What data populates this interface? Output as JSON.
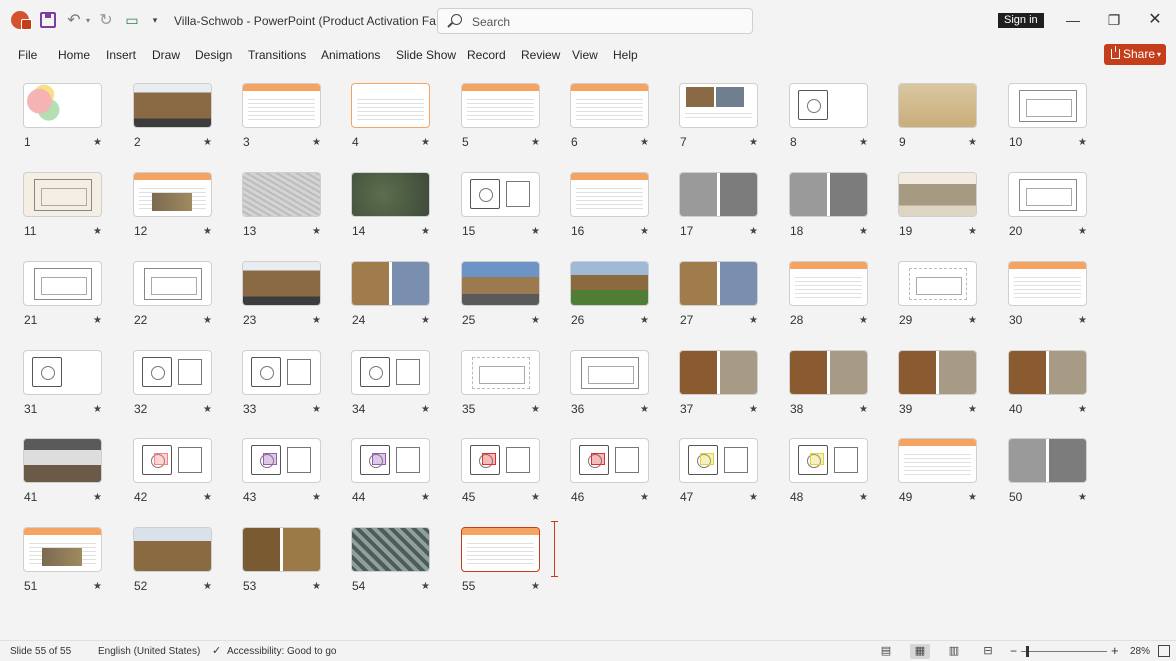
{
  "titlebar": {
    "app_icon": "powerpoint-icon",
    "doc_title": "Villa-Schwob  -  PowerPoint (Product Activation Fa...",
    "search_placeholder": "Search",
    "sign_in_label": "Sign in",
    "window_controls": [
      "minimize-icon",
      "restore-icon",
      "close-icon"
    ]
  },
  "ribbon": {
    "tabs": [
      "File",
      "Home",
      "Insert",
      "Draw",
      "Design",
      "Transitions",
      "Animations",
      "Slide Show",
      "Record",
      "Review",
      "View",
      "Help"
    ],
    "share_label": "Share"
  },
  "slides": [
    {
      "n": "1",
      "kind": "title"
    },
    {
      "n": "2",
      "kind": "photo-building"
    },
    {
      "n": "3",
      "kind": "text-figure"
    },
    {
      "n": "4",
      "kind": "text-orange"
    },
    {
      "n": "5",
      "kind": "text"
    },
    {
      "n": "6",
      "kind": "text-sketch"
    },
    {
      "n": "7",
      "kind": "photo-text"
    },
    {
      "n": "8",
      "kind": "plan"
    },
    {
      "n": "9",
      "kind": "drawing-old"
    },
    {
      "n": "10",
      "kind": "sketch-pair"
    },
    {
      "n": "11",
      "kind": "sketch-room"
    },
    {
      "n": "12",
      "kind": "text-map"
    },
    {
      "n": "13",
      "kind": "map"
    },
    {
      "n": "14",
      "kind": "aerial"
    },
    {
      "n": "15",
      "kind": "plan-lines"
    },
    {
      "n": "16",
      "kind": "text"
    },
    {
      "n": "17",
      "kind": "photo-bw-pair"
    },
    {
      "n": "18",
      "kind": "photo-bw-pair"
    },
    {
      "n": "19",
      "kind": "photo-sepia"
    },
    {
      "n": "20",
      "kind": "elevation"
    },
    {
      "n": "21",
      "kind": "elevation"
    },
    {
      "n": "22",
      "kind": "elevation"
    },
    {
      "n": "23",
      "kind": "photo-building"
    },
    {
      "n": "24",
      "kind": "photo-pair"
    },
    {
      "n": "25",
      "kind": "photo-street"
    },
    {
      "n": "26",
      "kind": "photo-garden"
    },
    {
      "n": "27",
      "kind": "photo-pair"
    },
    {
      "n": "28",
      "kind": "text"
    },
    {
      "n": "29",
      "kind": "sketch-light"
    },
    {
      "n": "30",
      "kind": "text"
    },
    {
      "n": "31",
      "kind": "plan"
    },
    {
      "n": "32",
      "kind": "plan-text"
    },
    {
      "n": "33",
      "kind": "plan-text"
    },
    {
      "n": "34",
      "kind": "plan-text"
    },
    {
      "n": "35",
      "kind": "sketch-light"
    },
    {
      "n": "36",
      "kind": "section"
    },
    {
      "n": "37",
      "kind": "photo-interior"
    },
    {
      "n": "38",
      "kind": "photo-interior"
    },
    {
      "n": "39",
      "kind": "photo-interior"
    },
    {
      "n": "40",
      "kind": "photo-interior"
    },
    {
      "n": "41",
      "kind": "photo-bedroom"
    },
    {
      "n": "42",
      "kind": "plan-color"
    },
    {
      "n": "43",
      "kind": "plan-purple"
    },
    {
      "n": "44",
      "kind": "plan-purple"
    },
    {
      "n": "45",
      "kind": "plan-red"
    },
    {
      "n": "46",
      "kind": "plan-red"
    },
    {
      "n": "47",
      "kind": "plan-yellow"
    },
    {
      "n": "48",
      "kind": "plan-yellow"
    },
    {
      "n": "49",
      "kind": "text"
    },
    {
      "n": "50",
      "kind": "photo-bw-pair"
    },
    {
      "n": "51",
      "kind": "text-photo"
    },
    {
      "n": "52",
      "kind": "photo-balcony"
    },
    {
      "n": "53",
      "kind": "photo-tree"
    },
    {
      "n": "54",
      "kind": "photo-grille"
    },
    {
      "n": "55",
      "kind": "text-selected"
    }
  ],
  "status": {
    "slide_counter": "Slide 55 of 55",
    "language": "English (United States)",
    "accessibility": "Accessibility: Good to go",
    "zoom": "28%"
  },
  "colors": {
    "accent": "#c43e1c",
    "slide_header": "#f4a460"
  }
}
